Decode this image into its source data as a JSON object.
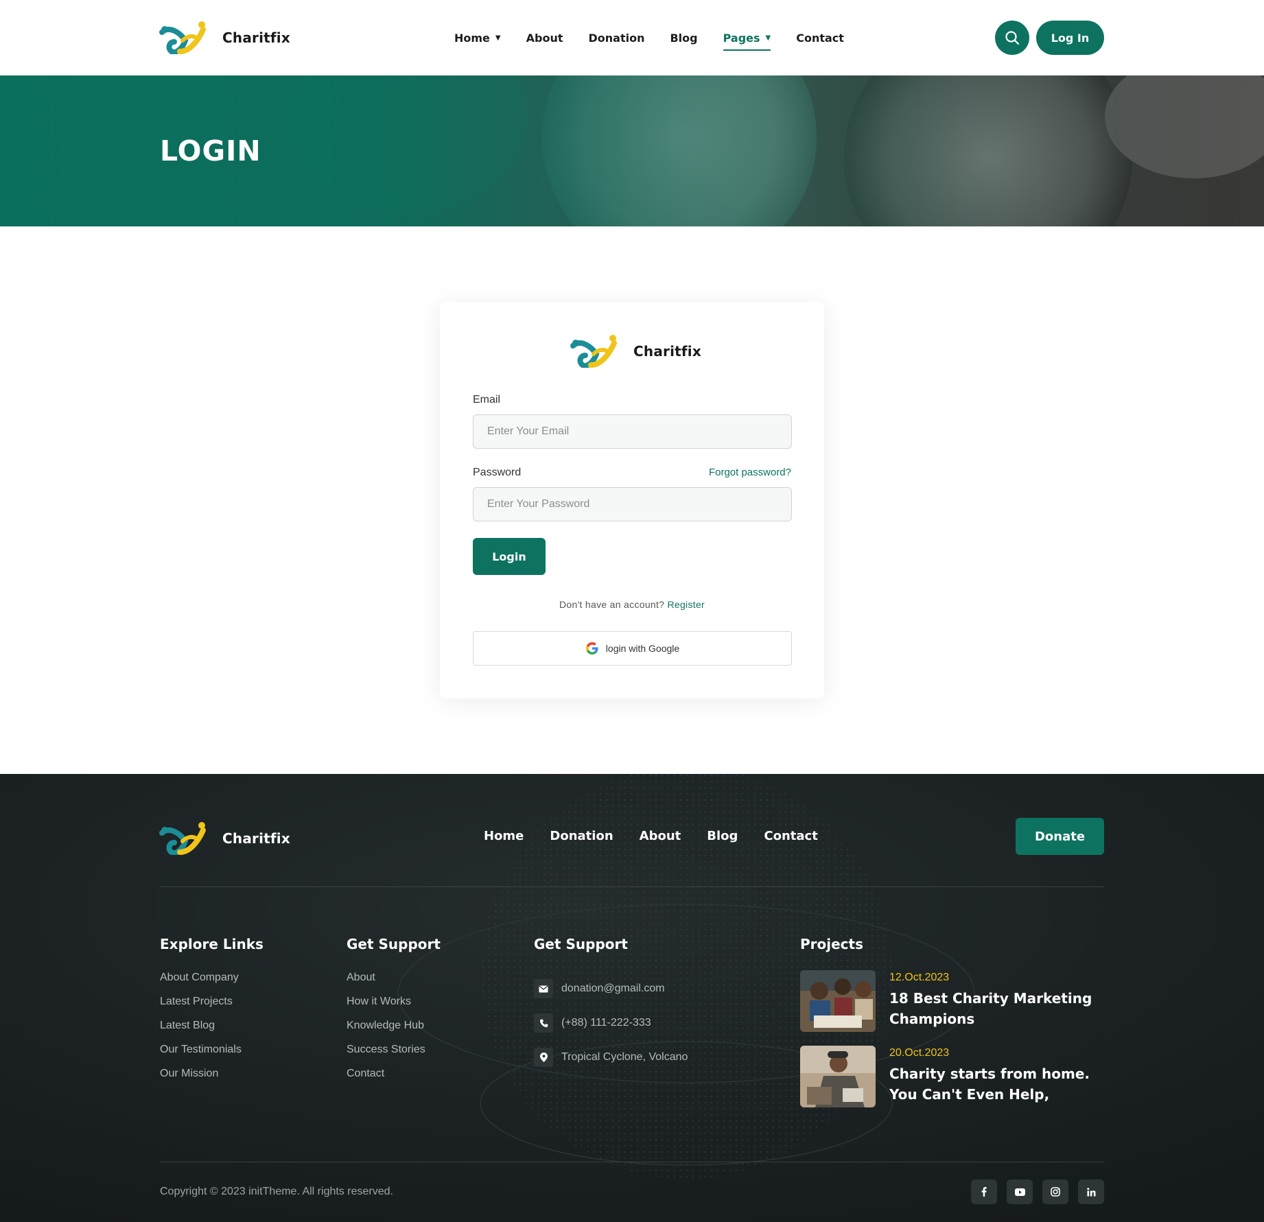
{
  "brand": {
    "name": "Charitfix"
  },
  "header": {
    "nav": [
      {
        "label": "Home",
        "has_dropdown": true,
        "active": false
      },
      {
        "label": "About",
        "has_dropdown": false,
        "active": false
      },
      {
        "label": "Donation",
        "has_dropdown": false,
        "active": false
      },
      {
        "label": "Blog",
        "has_dropdown": false,
        "active": false
      },
      {
        "label": "Pages",
        "has_dropdown": true,
        "active": true
      },
      {
        "label": "Contact",
        "has_dropdown": false,
        "active": false
      }
    ],
    "search_icon": "search-icon",
    "login_label": "Log In"
  },
  "hero": {
    "title": "LOGIN"
  },
  "login_form": {
    "email_label": "Email",
    "email_placeholder": "Enter Your Email",
    "email_value": "",
    "password_label": "Password",
    "password_placeholder": "Enter Your Password",
    "password_value": "",
    "forgot_label": "Forgot password?",
    "submit_label": "Login",
    "register_prompt": "Don't have an account?",
    "register_link": "Register",
    "google_label": "login with Google"
  },
  "footer": {
    "nav": [
      "Home",
      "Donation",
      "About",
      "Blog",
      "Contact"
    ],
    "donate_label": "Donate",
    "explore": {
      "title": "Explore Links",
      "links": [
        "About Company",
        "Latest Projects",
        "Latest Blog",
        "Our Testimonials",
        "Our Mission"
      ]
    },
    "support": {
      "title": "Get Support",
      "links": [
        "About",
        "How it Works",
        "Knowledge Hub",
        "Success Stories",
        "Contact"
      ]
    },
    "contact": {
      "title": "Get Support",
      "items": [
        {
          "icon": "mail-icon",
          "text": "donation@gmail.com"
        },
        {
          "icon": "phone-icon",
          "text": "(+88) 111-222-333"
        },
        {
          "icon": "location-pin-icon",
          "text": "Tropical Cyclone, Volcano"
        }
      ]
    },
    "projects": {
      "title": "Projects",
      "items": [
        {
          "date": "12.Oct.2023",
          "title": "18 Best Charity Marketing Champions"
        },
        {
          "date": "20.Oct.2023",
          "title": "Charity starts from home. You Can't Even Help,"
        }
      ]
    },
    "copyright": "Copyright © 2023 initTheme. All rights reserved.",
    "socials": [
      "facebook-icon",
      "youtube-icon",
      "instagram-icon",
      "linkedin-icon"
    ]
  },
  "colors": {
    "primary": "#0d7360",
    "accent_yellow": "#f0c419",
    "footer_bg": "#1d2324",
    "logo_teal": "#1c8d96"
  }
}
